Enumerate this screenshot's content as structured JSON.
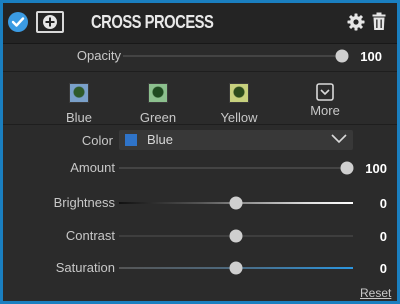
{
  "filter": {
    "title": "CROSS PROCESS"
  },
  "opacity": {
    "label": "Opacity",
    "value": "100",
    "level": 1.0
  },
  "presets": [
    {
      "label": "Blue"
    },
    {
      "label": "Green"
    },
    {
      "label": "Yellow"
    },
    {
      "label": "More"
    }
  ],
  "color": {
    "label": "Color",
    "value": "Blue",
    "swatch": "#2f74c9"
  },
  "sliders": [
    {
      "label": "Amount",
      "value": "100",
      "level": 1.0
    },
    {
      "label": "Brightness",
      "value": "0",
      "level": 0.5
    },
    {
      "label": "Contrast",
      "value": "0",
      "level": 0.5
    },
    {
      "label": "Saturation",
      "value": "0",
      "level": 0.5
    }
  ],
  "reset": {
    "label": "Reset"
  },
  "colors": {
    "accent": "#1a7fc0",
    "check": "#3b9be3",
    "panel": "#2b2b2b"
  }
}
